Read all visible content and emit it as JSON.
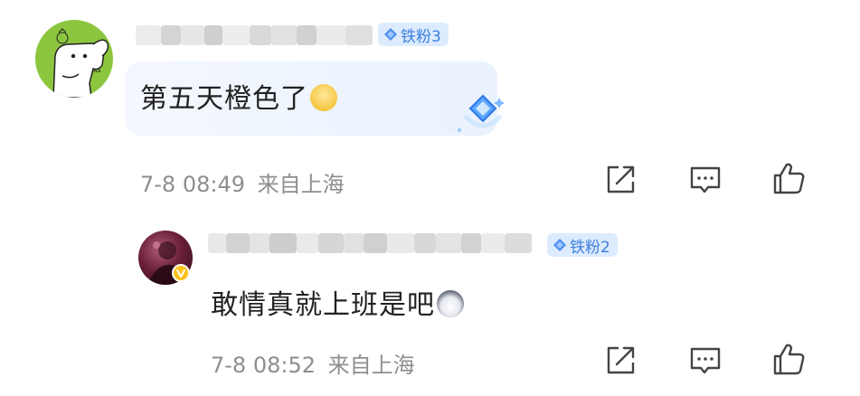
{
  "comment": {
    "username_blurred": true,
    "badge": {
      "label": "铁粉3",
      "icon": "diamond-icon"
    },
    "text": "第五天橙色了",
    "emoji": "smiling-face-emoji",
    "timestamp": "7-8 08:49",
    "location": "来自上海",
    "actions": [
      "share-icon",
      "comment-icon",
      "like-icon"
    ]
  },
  "reply": {
    "username_blurred": true,
    "verified": true,
    "badge": {
      "label": "铁粉2",
      "icon": "diamond-icon"
    },
    "text": "敢情真就上班是吧",
    "emoji": "husky-dog-emoji",
    "timestamp": "7-8 08:52",
    "location": "来自上海",
    "actions": [
      "share-icon",
      "comment-icon",
      "like-icon"
    ]
  },
  "colors": {
    "badge_bg": "#dcebfd",
    "badge_text": "#3d7fe0",
    "meta_text": "#8e8e8e",
    "avatar_green": "#8cc63f",
    "verified_gold": "#ffc21a"
  }
}
